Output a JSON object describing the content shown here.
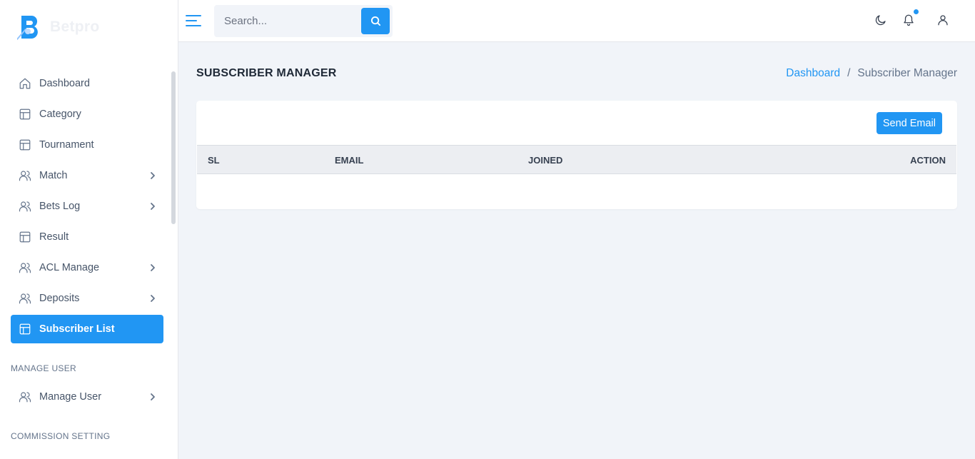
{
  "brand": {
    "name": "Betpro"
  },
  "colors": {
    "accent": "#2196f3",
    "sidebar_bg": "#ffffff",
    "content_bg": "#f1f4f9"
  },
  "sidebar": {
    "items": [
      {
        "label": "Dashboard",
        "icon": "home-icon",
        "has_chevron": false,
        "active": false
      },
      {
        "label": "Category",
        "icon": "layout-icon",
        "has_chevron": false,
        "active": false
      },
      {
        "label": "Tournament",
        "icon": "layout-icon",
        "has_chevron": false,
        "active": false
      },
      {
        "label": "Match",
        "icon": "users-icon",
        "has_chevron": true,
        "active": false
      },
      {
        "label": "Bets Log",
        "icon": "users-icon",
        "has_chevron": true,
        "active": false
      },
      {
        "label": "Result",
        "icon": "layout-icon",
        "has_chevron": false,
        "active": false
      },
      {
        "label": "ACL Manage",
        "icon": "users-icon",
        "has_chevron": true,
        "active": false
      },
      {
        "label": "Deposits",
        "icon": "users-icon",
        "has_chevron": true,
        "active": false
      },
      {
        "label": "Subscriber List",
        "icon": "layout-icon",
        "has_chevron": false,
        "active": true
      }
    ],
    "manage_user_section": "MANAGE USER",
    "manage_user_item": {
      "label": "Manage User",
      "icon": "users-icon",
      "has_chevron": true
    },
    "commission_section": "COMMISSION SETTING"
  },
  "topbar": {
    "menu_icon": "hamburger-icon",
    "search": {
      "placeholder": "Search...",
      "value": "",
      "icon": "search-icon"
    },
    "icons": [
      "moon-icon",
      "bell-icon",
      "user-icon"
    ]
  },
  "page": {
    "title": "SUBSCRIBER MANAGER",
    "breadcrumb": {
      "home": "Dashboard",
      "separator": "/",
      "current": "Subscriber Manager"
    },
    "send_email_label": "Send Email",
    "table": {
      "columns": [
        "SL",
        "EMAIL",
        "JOINED",
        "ACTION"
      ],
      "rows": []
    }
  }
}
